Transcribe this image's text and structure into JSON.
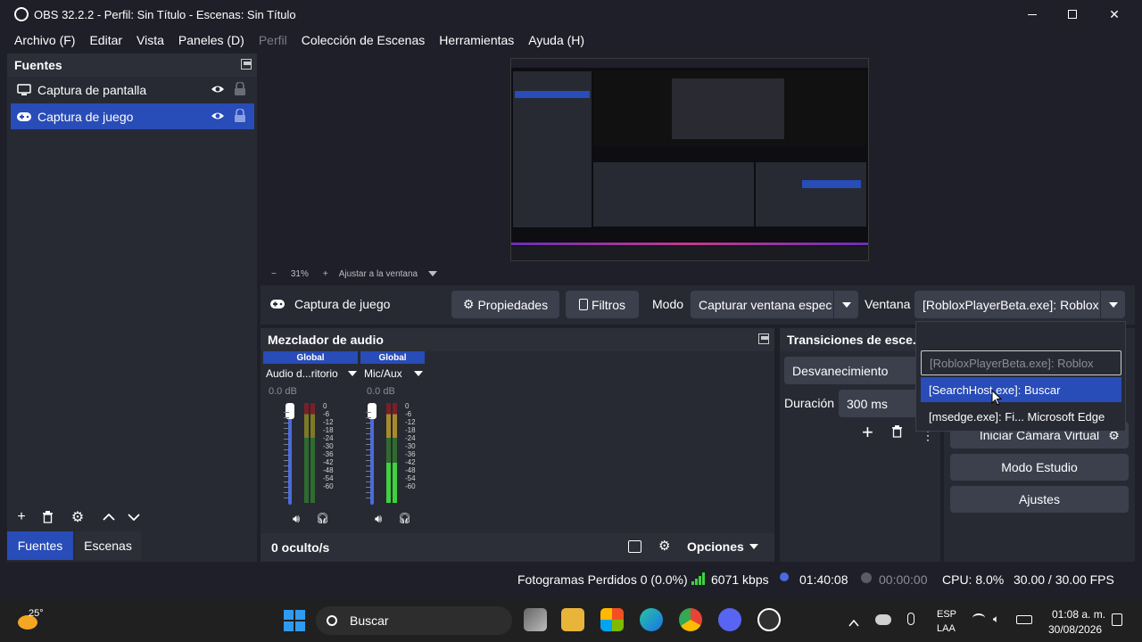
{
  "window": {
    "title": "OBS 32.2.2 - Perfil: Sin Título - Escenas: Sin Título",
    "controls": [
      "minimize-icon",
      "maximize-icon",
      "close-icon"
    ]
  },
  "menu": {
    "archivo": "Archivo (F)",
    "editar": "Editar",
    "vista": "Vista",
    "paneles": "Paneles (D)",
    "perfil": "Perfil",
    "coleccion": "Colección de Escenas",
    "herramientas": "Herramientas",
    "ayuda": "Ayuda (H)"
  },
  "sources": {
    "title": "Fuentes",
    "items": [
      {
        "label": "Captura de pantalla",
        "icon": "monitor-icon"
      },
      {
        "label": "Captura de juego",
        "icon": "gamepad-icon"
      }
    ]
  },
  "bottom_tabs": {
    "fuentes": "Fuentes",
    "escenas": "Escenas"
  },
  "preview": {
    "zoom": "31%",
    "fit": "Ajustar a la ventana"
  },
  "properties_bar": {
    "source_name": "Captura de juego",
    "properties_label": "Propiedades",
    "filters_label": "Filtros",
    "mode_label": "Modo",
    "mode_value": "Capturar ventana especí",
    "window_label": "Ventana",
    "window_value": "[RobloxPlayerBeta.exe]: Roblox"
  },
  "window_dropdown": {
    "options": [
      "[RobloxPlayerBeta.exe]: Roblox",
      "[SearchHost.exe]: Buscar",
      "[msedge.exe]: Fi... Microsoft Edge"
    ],
    "highlighted": "[SearchHost.exe]: Buscar"
  },
  "mixer": {
    "title": "Mezclador de audio",
    "channels": [
      {
        "header": "Global",
        "name": "Audio d...ritorio",
        "db": "0.0 dB",
        "level": 0.25
      },
      {
        "header": "Global",
        "name": "Mic/Aux",
        "db": "0.0 dB",
        "level": 0.4
      }
    ],
    "scale": [
      "0",
      "-6",
      "-12",
      "-18",
      "-24",
      "-30",
      "-36",
      "-42",
      "-48",
      "-54",
      "-60"
    ],
    "hidden_count": "0 oculto/s",
    "options_label": "Opciones"
  },
  "transitions": {
    "title": "Transiciones de esce...",
    "type": "Desvanecimiento",
    "duration_label": "Duración",
    "duration_value": "300 ms"
  },
  "controls": {
    "virtual_cam": "Iniciar Cámara Virtual",
    "studio_mode": "Modo Estudio",
    "settings": "Ajustes"
  },
  "status": {
    "dropped_frames": "Fotogramas Perdidos 0 (0.0%)",
    "bitrate": "6071 kbps",
    "stream_time": "01:40:08",
    "rec_time": "00:00:00",
    "cpu": "CPU: 8.0%",
    "fps": "30.00 / 30.00 FPS"
  },
  "taskbar": {
    "weather_temp": "25°",
    "search_placeholder": "Buscar",
    "lang_top": "ESP",
    "lang_bottom": "LAA",
    "time": "01:08 a. m.",
    "date": "30/08/2026",
    "colors": {
      "accent": "#284cb8",
      "bg": "#202020"
    }
  }
}
